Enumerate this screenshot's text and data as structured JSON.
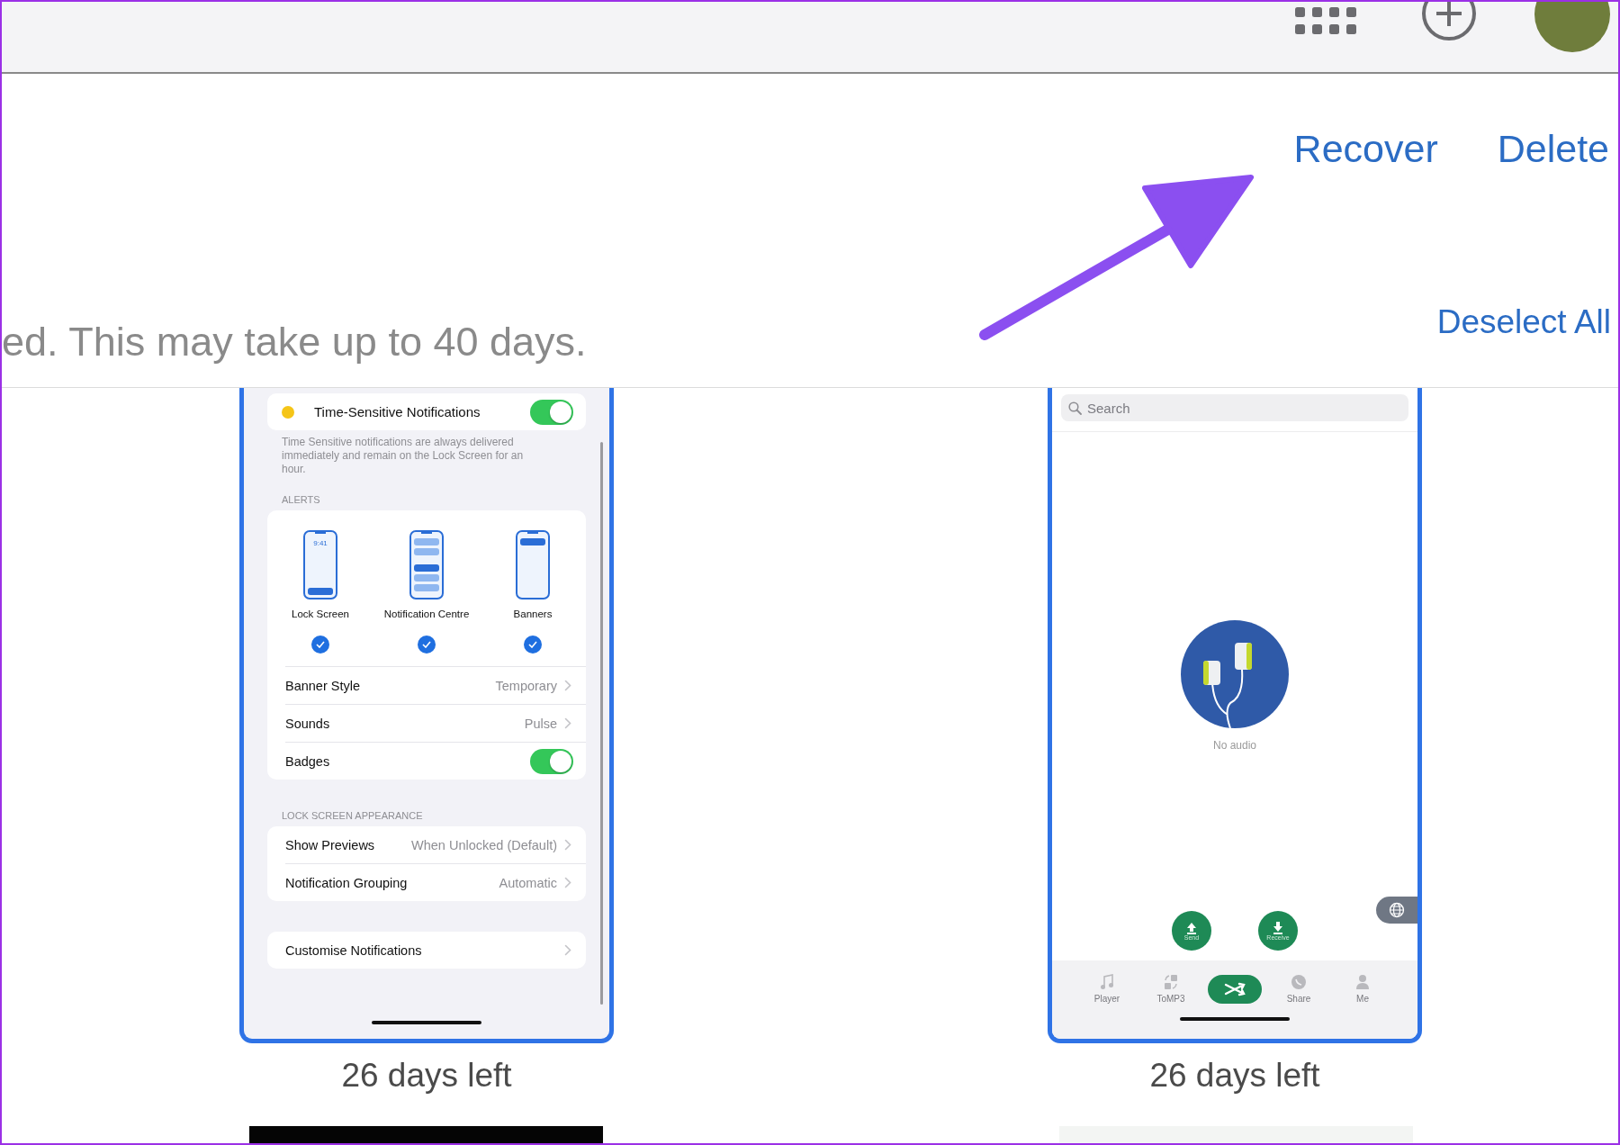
{
  "toolbar": {
    "actions": [
      "Recover",
      "Delete"
    ]
  },
  "notice": {
    "text": "ed. This may take up to 40 days.",
    "action": "Deselect All"
  },
  "items": [
    {
      "kind": "settings",
      "selected": true,
      "caption": "26 days left",
      "screen": {
        "time_sensitive": {
          "label": "Time-Sensitive Notifications",
          "on": true
        },
        "footnote": "Time Sensitive notifications are always delivered immediately and remain on the Lock Screen for an hour.",
        "alerts_header": "ALERTS",
        "alert_styles": [
          {
            "kind": "lock",
            "label": "Lock Screen",
            "time": "9:41",
            "checked": true
          },
          {
            "kind": "centre",
            "label": "Notification Centre",
            "checked": true
          },
          {
            "kind": "banner",
            "label": "Banners",
            "checked": true
          }
        ],
        "alert_rows": [
          {
            "kind": "value",
            "label": "Banner Style",
            "value": "Temporary"
          },
          {
            "kind": "value",
            "label": "Sounds",
            "value": "Pulse"
          },
          {
            "kind": "toggle",
            "label": "Badges",
            "on": true
          }
        ],
        "lock_header": "LOCK SCREEN APPEARANCE",
        "lock_rows": [
          {
            "kind": "value",
            "label": "Show Previews",
            "value": "When Unlocked (Default)"
          },
          {
            "kind": "value",
            "label": "Notification Grouping",
            "value": "Automatic"
          }
        ],
        "extra_rows": [
          {
            "kind": "link",
            "label": "Customise Notifications"
          }
        ]
      }
    },
    {
      "kind": "app",
      "selected": true,
      "caption": "26 days left",
      "screen": {
        "search": {
          "placeholder": "Search"
        },
        "empty_text": "No audio",
        "actions": [
          {
            "kind": "send",
            "label": "Send"
          },
          {
            "kind": "receive",
            "label": "Receive"
          }
        ],
        "tabs": [
          {
            "kind": "music",
            "label": "Player"
          },
          {
            "kind": "convert",
            "label": "ToMP3"
          },
          {
            "kind": "center"
          },
          {
            "kind": "share",
            "label": "Share"
          },
          {
            "kind": "person",
            "label": "Me"
          }
        ]
      }
    }
  ],
  "more_items": [
    {
      "kind": "dark"
    },
    {
      "kind": "light"
    }
  ]
}
